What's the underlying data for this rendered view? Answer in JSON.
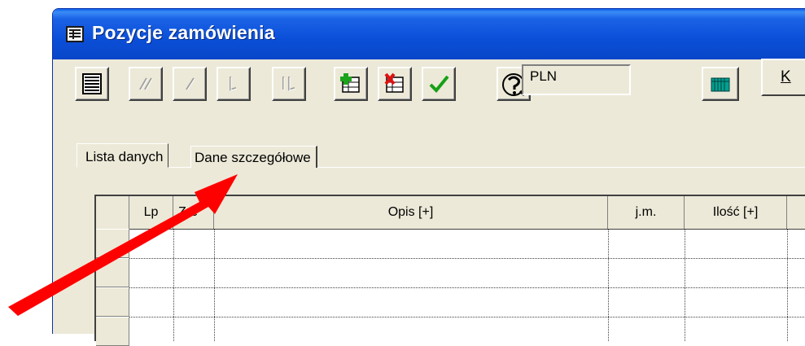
{
  "window": {
    "title": "Pozycje zamówienia"
  },
  "toolbar": {
    "currency_value": "PLN",
    "k_button_label": "K"
  },
  "tabs": [
    {
      "label": "Lista danych",
      "active": true
    },
    {
      "label": "Dane szczegółowe",
      "active": false
    }
  ],
  "grid": {
    "columns": [
      "Lp",
      "Zre",
      "Opis [+]",
      "j.m.",
      "Ilość [+]"
    ]
  },
  "annotation": {
    "arrow_color": "#ff0000"
  },
  "colors": {
    "titlebar": "#0b4fd8",
    "window_bg": "#ece9d8",
    "add_icon": "#1ca31c",
    "delete_icon": "#e01010",
    "accept_icon": "#16a016",
    "currency_icon": "#00a090"
  }
}
